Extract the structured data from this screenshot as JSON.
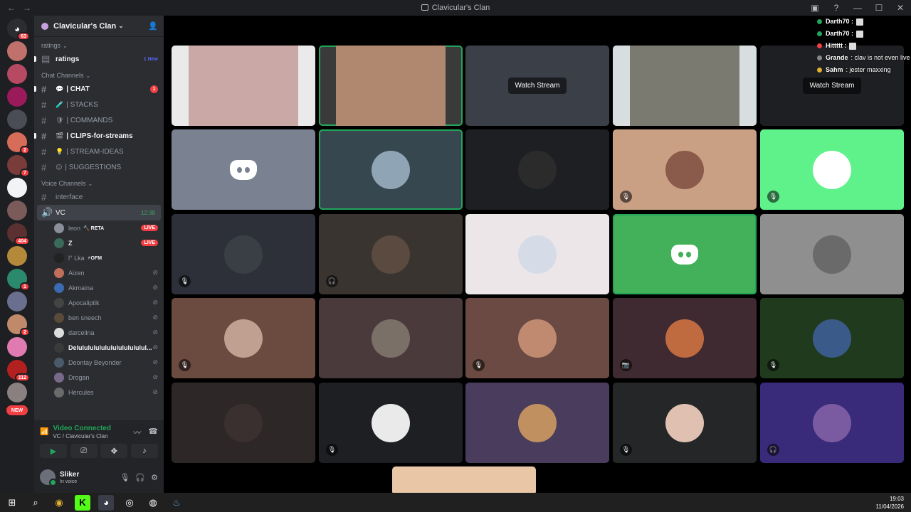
{
  "window": {
    "title": "Clavicular's Clan"
  },
  "rail": {
    "home_badge": "63",
    "servers": [
      {
        "color": "#c1716b",
        "badge": ""
      },
      {
        "color": "#b74a63",
        "badge": ""
      },
      {
        "color": "#9b1b5a",
        "badge": ""
      },
      {
        "color": "#4a4d55",
        "badge": ""
      },
      {
        "color": "#d56d58",
        "badge": "2"
      },
      {
        "color": "#7a3b3b",
        "badge": "7"
      },
      {
        "color": "#f2f3f5",
        "badge": ""
      },
      {
        "color": "#7b5a5a",
        "badge": ""
      },
      {
        "color": "#5a3030",
        "badge": "404"
      },
      {
        "color": "#b48a3a",
        "badge": ""
      },
      {
        "color": "#2b8a6b",
        "badge": "1"
      },
      {
        "color": "#6a6f90",
        "badge": ""
      },
      {
        "color": "#c08a6a",
        "badge": "2"
      },
      {
        "color": "#e07bb2",
        "badge": ""
      },
      {
        "color": "#b32020",
        "badge": "112"
      },
      {
        "color": "#8a8080",
        "badge": ""
      }
    ],
    "new_label": "NEW"
  },
  "sidebar": {
    "guild_name": "Clavicular's Clan",
    "cat_ratings": "ratings",
    "ratings": {
      "label": "ratings",
      "new": "1 New"
    },
    "cat_chat": "Chat Channels",
    "channels": [
      {
        "emoji": "💬",
        "name": "| CHAT",
        "unread": true,
        "badge": "1"
      },
      {
        "emoji": "🧪",
        "name": "| STACKS",
        "unread": false,
        "badge": ""
      },
      {
        "emoji": "🛡",
        "name": "| COMMANDS",
        "unread": false,
        "badge": ""
      },
      {
        "emoji": "🎬",
        "name": "| CLIPS-for-streams",
        "unread": true,
        "badge": ""
      },
      {
        "emoji": "💡",
        "name": "| STREAM-IDEAS",
        "unread": false,
        "badge": ""
      },
      {
        "emoji": "😐",
        "name": "| SUGGESTIONS",
        "unread": false,
        "badge": ""
      }
    ],
    "cat_voice": "Voice Channels",
    "voice_interface": "interface",
    "vc": {
      "name": "VC",
      "timer": "12:38"
    },
    "voice_users": [
      {
        "name": "leon",
        "activity": "🔨 RETA",
        "live": "LIVE",
        "bold": false,
        "color": "#8a8f99"
      },
      {
        "name": "Z",
        "activity": "",
        "live": "LIVE",
        "bold": true,
        "color": "#3a6a5a"
      },
      {
        "name": "l° Lka",
        "activity": "⚡OFM",
        "live": "",
        "bold": false,
        "color": "#222"
      },
      {
        "name": "Aizen",
        "activity": "",
        "live": "",
        "bold": false,
        "color": "#c0705a"
      },
      {
        "name": "Akmaina",
        "activity": "",
        "live": "",
        "bold": false,
        "color": "#3a6ab0"
      },
      {
        "name": "Apocaliptik",
        "activity": "",
        "live": "",
        "bold": false,
        "color": "#444"
      },
      {
        "name": "ben sneech",
        "activity": "",
        "live": "",
        "bold": false,
        "color": "#5a4a3a"
      },
      {
        "name": "darcelina",
        "activity": "",
        "live": "",
        "bold": false,
        "color": "#ddd"
      },
      {
        "name": "Delulululululululululululul...",
        "activity": "",
        "live": "",
        "bold": true,
        "color": "#3a3a3a"
      },
      {
        "name": "Deontay Beyonder",
        "activity": "",
        "live": "",
        "bold": false,
        "color": "#4a5a6a"
      },
      {
        "name": "Drogan",
        "activity": "",
        "live": "",
        "bold": false,
        "color": "#7a6a8a"
      },
      {
        "name": "Hercules",
        "activity": "",
        "live": "",
        "bold": false,
        "color": "#6a6a6a"
      }
    ],
    "voice_panel": {
      "status": "Video Connected",
      "location": "VC / Clavicular's Clan"
    },
    "user": {
      "name": "Sliker",
      "status": "In voice"
    }
  },
  "chat_overlay": [
    {
      "name": "Darth70 :",
      "dot": "#23a55a",
      "msg": ""
    },
    {
      "name": "Darth70 :",
      "dot": "#23a55a",
      "msg": ""
    },
    {
      "name": "Hittttt :",
      "dot": "#f23f43",
      "msg": ""
    },
    {
      "name": "Grande",
      "dot": "#888",
      "msg": ": clav is not even live"
    },
    {
      "name": "Sahm",
      "dot": "#e0b030",
      "msg": ": jester maxxing"
    }
  ],
  "tiles": [
    {
      "bg": "#eaeaea",
      "pic": "",
      "mute": "",
      "watch": "",
      "speaking": false,
      "logo": false,
      "video": "#c9a8a5"
    },
    {
      "bg": "#3a3a3a",
      "pic": "",
      "mute": "",
      "watch": "",
      "speaking": true,
      "logo": false,
      "video": "#b08870"
    },
    {
      "bg": "#3a3f48",
      "pic": "",
      "mute": "",
      "watch": "Watch Stream",
      "speaking": false,
      "logo": false,
      "video": ""
    },
    {
      "bg": "#d8dde0",
      "pic": "",
      "mute": "",
      "watch": "",
      "speaking": false,
      "logo": false,
      "video": "#7a7a70"
    },
    {
      "bg": "#1e1f22",
      "pic": "",
      "mute": "",
      "watch": "Watch Stream",
      "speaking": false,
      "logo": false,
      "video": ""
    },
    {
      "bg": "#7a8190",
      "pic": "",
      "mute": "",
      "watch": "",
      "speaking": false,
      "logo": true,
      "video": ""
    },
    {
      "bg": "#37474f",
      "pic": "#8fa5b5",
      "mute": "",
      "watch": "",
      "speaking": true,
      "logo": false,
      "video": ""
    },
    {
      "bg": "#1e1f22",
      "pic": "#2b2b2b",
      "mute": "",
      "watch": "",
      "speaking": false,
      "logo": false,
      "video": ""
    },
    {
      "bg": "#caa084",
      "pic": "#8a5a4a",
      "mute": "🎙",
      "watch": "",
      "speaking": false,
      "logo": false,
      "video": ""
    },
    {
      "bg": "#5ff28a",
      "pic": "#ffffff",
      "mute": "🎙",
      "watch": "",
      "speaking": false,
      "logo": false,
      "video": ""
    },
    {
      "bg": "#2d3039",
      "pic": "#3a3e45",
      "mute": "🎙",
      "watch": "",
      "speaking": false,
      "logo": false,
      "video": ""
    },
    {
      "bg": "#39342f",
      "pic": "#5a4a40",
      "mute": "🎧",
      "watch": "",
      "speaking": false,
      "logo": false,
      "video": ""
    },
    {
      "bg": "#ece6e8",
      "pic": "#d6dbe8",
      "mute": "",
      "watch": "",
      "speaking": false,
      "logo": false,
      "video": ""
    },
    {
      "bg": "#43b05a",
      "pic": "",
      "mute": "",
      "watch": "",
      "speaking": true,
      "logo": true,
      "video": ""
    },
    {
      "bg": "#8f8f8f",
      "pic": "#6a6a6a",
      "mute": "",
      "watch": "",
      "speaking": false,
      "logo": false,
      "video": ""
    },
    {
      "bg": "#6b4a40",
      "pic": "#c0a090",
      "mute": "🎙",
      "watch": "",
      "speaking": false,
      "logo": false,
      "video": ""
    },
    {
      "bg": "#4a3a3c",
      "pic": "#7a7068",
      "mute": "",
      "watch": "",
      "speaking": false,
      "logo": false,
      "video": ""
    },
    {
      "bg": "#6a4a42",
      "pic": "#c08a70",
      "mute": "🎙",
      "watch": "",
      "speaking": false,
      "logo": false,
      "video": ""
    },
    {
      "bg": "#3e2a30",
      "pic": "#c06a40",
      "mute": "📷",
      "watch": "",
      "speaking": false,
      "logo": false,
      "video": ""
    },
    {
      "bg": "#203a1e",
      "pic": "#3a5a8a",
      "mute": "🎙",
      "watch": "",
      "speaking": false,
      "logo": false,
      "video": ""
    },
    {
      "bg": "#2e2727",
      "pic": "#3a3030",
      "mute": "",
      "watch": "",
      "speaking": false,
      "logo": false,
      "video": ""
    },
    {
      "bg": "#1e1f22",
      "pic": "#eaeaea",
      "mute": "🎙",
      "watch": "",
      "speaking": false,
      "logo": false,
      "video": ""
    },
    {
      "bg": "#4a3c5c",
      "pic": "#c09060",
      "mute": "",
      "watch": "",
      "speaking": false,
      "logo": false,
      "video": ""
    },
    {
      "bg": "#252628",
      "pic": "#e0c0b0",
      "mute": "🎙",
      "watch": "",
      "speaking": false,
      "logo": false,
      "video": ""
    },
    {
      "bg": "#3a2a7a",
      "pic": "#7a5aa0",
      "mute": "🎧",
      "watch": "",
      "speaking": false,
      "logo": false,
      "video": ""
    }
  ],
  "taskbar": {
    "time": "19:03",
    "date": "11/04/2026"
  }
}
